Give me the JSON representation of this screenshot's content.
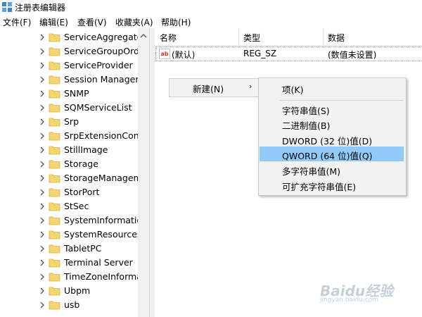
{
  "window": {
    "title": "注册表编辑器"
  },
  "menu": [
    {
      "label": "文件(F)"
    },
    {
      "label": "编辑(E)"
    },
    {
      "label": "查看(V)"
    },
    {
      "label": "收藏夹(A)"
    },
    {
      "label": "帮助(H)"
    }
  ],
  "tree": {
    "items": [
      {
        "label": "ServiceAggregate"
      },
      {
        "label": "ServiceGroupOrde"
      },
      {
        "label": "ServiceProvider"
      },
      {
        "label": "Session Manager"
      },
      {
        "label": "SNMP"
      },
      {
        "label": "SQMServiceList"
      },
      {
        "label": "Srp"
      },
      {
        "label": "SrpExtensionConfi"
      },
      {
        "label": "StillImage"
      },
      {
        "label": "Storage"
      },
      {
        "label": "StorageManagem"
      },
      {
        "label": "StorPort"
      },
      {
        "label": "StSec"
      },
      {
        "label": "SystemInformation"
      },
      {
        "label": "SystemResources"
      },
      {
        "label": "TabletPC"
      },
      {
        "label": "Terminal Server"
      },
      {
        "label": "TimeZoneInforma"
      },
      {
        "label": "Ubpm"
      },
      {
        "label": "usb"
      }
    ]
  },
  "list": {
    "columns": {
      "name": "名称",
      "type": "类型",
      "data": "数据"
    },
    "rows": [
      {
        "icon": "string-value-icon",
        "icon_text": "ab",
        "name": "(默认)",
        "type": "REG_SZ",
        "data": "(数值未设置)"
      }
    ]
  },
  "new_menu": {
    "label": "新建(N)",
    "arrow": "›"
  },
  "context_menu": {
    "items": [
      {
        "label": "项(K)"
      },
      {
        "label": "字符串值(S)"
      },
      {
        "label": "二进制值(B)"
      },
      {
        "label": "DWORD (32 位)值(D)"
      },
      {
        "label": "QWORD (64 位)值(Q)"
      },
      {
        "label": "多字符串值(M)"
      },
      {
        "label": "可扩充字符串值(E)"
      }
    ],
    "highlighted_index": 4
  },
  "watermark": {
    "text": "Baidu经验",
    "sub": "jingyan.baidu.com"
  },
  "colors": {
    "highlight": "#91c9f7",
    "menu_bg": "#f2f2f2",
    "folder": "#f7d56e"
  }
}
